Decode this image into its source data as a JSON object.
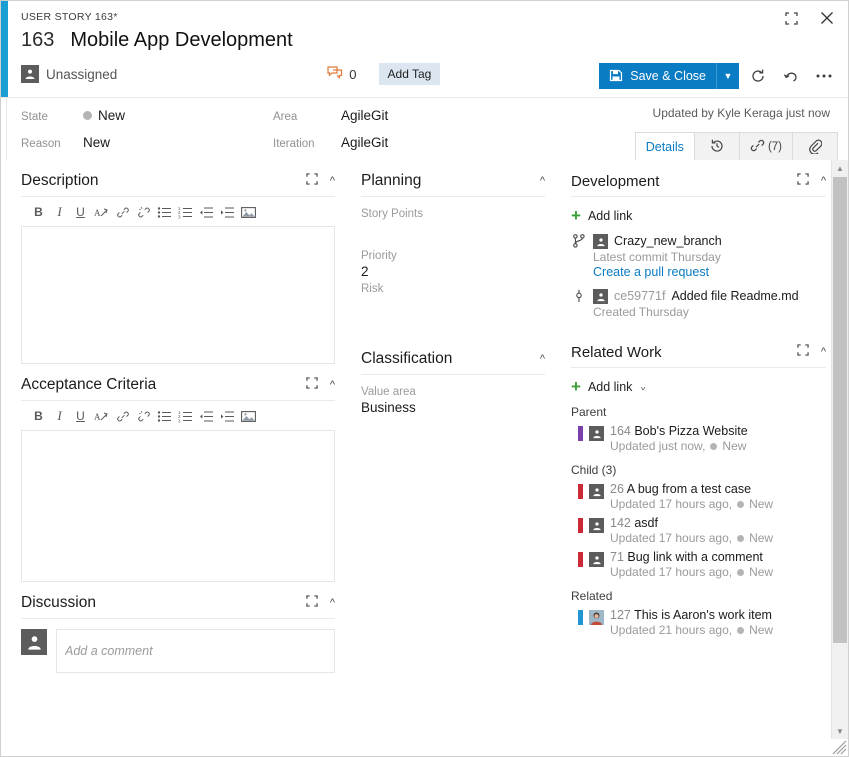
{
  "header": {
    "breadcrumb": "USER STORY 163*",
    "work_item_id": "163",
    "title": "Mobile App Development",
    "assignee": "Unassigned",
    "discussion_count": "0",
    "add_tag_label": "Add Tag",
    "save_label": "Save & Close",
    "accent_color": "#1a9ed4",
    "save_color": "#0a7cc4",
    "icons": {
      "maximize": "maximize-icon",
      "close": "close-icon",
      "refresh": "refresh-icon",
      "undo": "undo-icon",
      "more": "more-actions-icon"
    }
  },
  "fields": {
    "state_label": "State",
    "state_value": "New",
    "reason_label": "Reason",
    "reason_value": "New",
    "area_label": "Area",
    "area_value": "AgileGit",
    "iteration_label": "Iteration",
    "iteration_value": "AgileGit",
    "updated_by": "Updated by Kyle Keraga just now"
  },
  "tabs": [
    {
      "label": "Details",
      "icon": "",
      "count": "",
      "active": true
    },
    {
      "label": "",
      "icon": "history-icon",
      "count": "",
      "active": false
    },
    {
      "label": "",
      "icon": "link-icon",
      "count": "(7)",
      "active": false
    },
    {
      "label": "",
      "icon": "attachment-icon",
      "count": "",
      "active": false
    }
  ],
  "editor_toolbar": [
    "bold-icon",
    "italic-icon",
    "underline-icon",
    "clear-format-icon",
    "link-icon",
    "unlink-icon",
    "bullet-list-icon",
    "numbered-list-icon",
    "outdent-icon",
    "indent-icon",
    "image-icon"
  ],
  "description": {
    "title": "Description",
    "value": ""
  },
  "acceptance": {
    "title": "Acceptance Criteria",
    "value": ""
  },
  "discussion": {
    "title": "Discussion",
    "placeholder": "Add a comment"
  },
  "planning": {
    "title": "Planning",
    "fields": [
      {
        "label": "Story Points",
        "value": ""
      },
      {
        "label": "Priority",
        "value": "2"
      },
      {
        "label": "Risk",
        "value": ""
      }
    ]
  },
  "classification": {
    "title": "Classification",
    "fields": [
      {
        "label": "Value area",
        "value": "Business"
      }
    ]
  },
  "development": {
    "title": "Development",
    "add_link_label": "Add link",
    "items": [
      {
        "glyph": "branch-icon",
        "name": "Crazy_new_branch",
        "sha": "",
        "subtitle": "Latest commit Thursday",
        "link": "Create a pull request"
      },
      {
        "glyph": "commit-icon",
        "name": "Added file Readme.md",
        "sha": "ce59771f",
        "subtitle": "Created Thursday",
        "link": ""
      }
    ]
  },
  "related_work": {
    "title": "Related Work",
    "add_link_label": "Add link",
    "groups": [
      {
        "label": "Parent",
        "items": [
          {
            "bar_color": "#7a3fa8",
            "avatar": "unassigned-avatar",
            "id": "164",
            "title": "Bob's Pizza Website",
            "updated": "Updated just now,",
            "state": "New"
          }
        ]
      },
      {
        "label": "Child (3)",
        "items": [
          {
            "bar_color": "#cc2936",
            "avatar": "unassigned-avatar",
            "id": "26",
            "title": "A bug from a test case",
            "updated": "Updated 17 hours ago,",
            "state": "New"
          },
          {
            "bar_color": "#cc2936",
            "avatar": "unassigned-avatar",
            "id": "142",
            "title": "asdf",
            "updated": "Updated 17 hours ago,",
            "state": "New"
          },
          {
            "bar_color": "#cc2936",
            "avatar": "unassigned-avatar",
            "id": "71",
            "title": "Bug link with a comment",
            "updated": "Updated 17 hours ago,",
            "state": "New"
          }
        ]
      },
      {
        "label": "Related",
        "items": [
          {
            "bar_color": "#2196d4",
            "avatar": "user-photo-avatar",
            "id": "127",
            "title": "This is Aaron's work item",
            "updated": "Updated 21 hours ago,",
            "state": "New"
          }
        ]
      }
    ]
  }
}
